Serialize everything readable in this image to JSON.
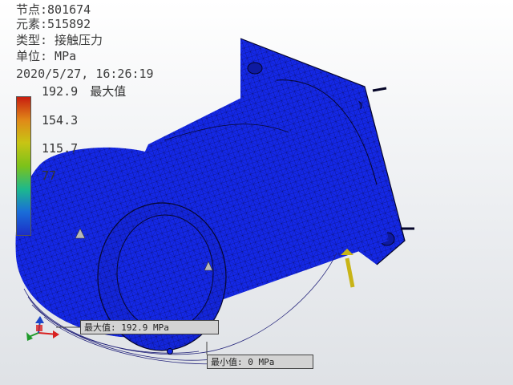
{
  "info": {
    "nodes": "节点:801674",
    "elements": "元素:515892",
    "type": "类型: 接触压力",
    "unit": "单位: MPa",
    "timestamp": "2020/5/27, 16:26:19"
  },
  "legend": {
    "max_value": "192.9",
    "max_tag": "最大值",
    "labels": [
      "154.3",
      "115.7",
      "77"
    ],
    "colors": [
      "#c81e10",
      "#e08a18",
      "#c8c414",
      "#7cc21a",
      "#1cb88e",
      "#1a6ed8",
      "#1b2ec8"
    ]
  },
  "callouts": {
    "max": "最大值: 192.9 MPa",
    "min": "最小值: 0 MPa"
  },
  "colors": {
    "model_fill": "#1428e6",
    "mesh_line": "#0a0a50",
    "probe": "#c8b417"
  },
  "icons": [
    "view-axis-triad-icon",
    "load-arrow-icon",
    "max-probe-icon"
  ]
}
